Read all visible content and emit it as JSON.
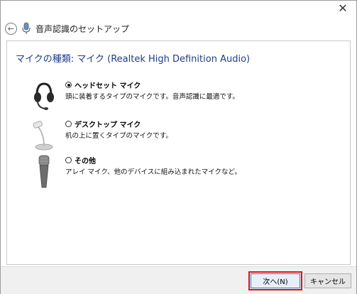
{
  "window": {
    "close_glyph": "✕"
  },
  "header": {
    "back_icon": "back-arrow-icon",
    "title": "音声認識のセットアップ"
  },
  "section": {
    "title": "マイクの種類: マイク (Realtek High Definition Audio)"
  },
  "options": [
    {
      "label": "ヘッドセット マイク",
      "description": "頭に装着するタイプのマイクです。音声認識に最適です。",
      "checked": true,
      "icon": "headset-icon"
    },
    {
      "label": "デスクトップ マイク",
      "description": "机の上に置くタイプのマイクです。",
      "checked": false,
      "icon": "desktop-mic-icon"
    },
    {
      "label": "その他",
      "description": "アレイ マイク、他のデバイスに組み込まれたマイクなど。",
      "checked": false,
      "icon": "handheld-mic-icon"
    }
  ],
  "footer": {
    "next_label": "次へ(N)",
    "cancel_label": "キャンセル",
    "highlight_color": "#e0101a"
  }
}
